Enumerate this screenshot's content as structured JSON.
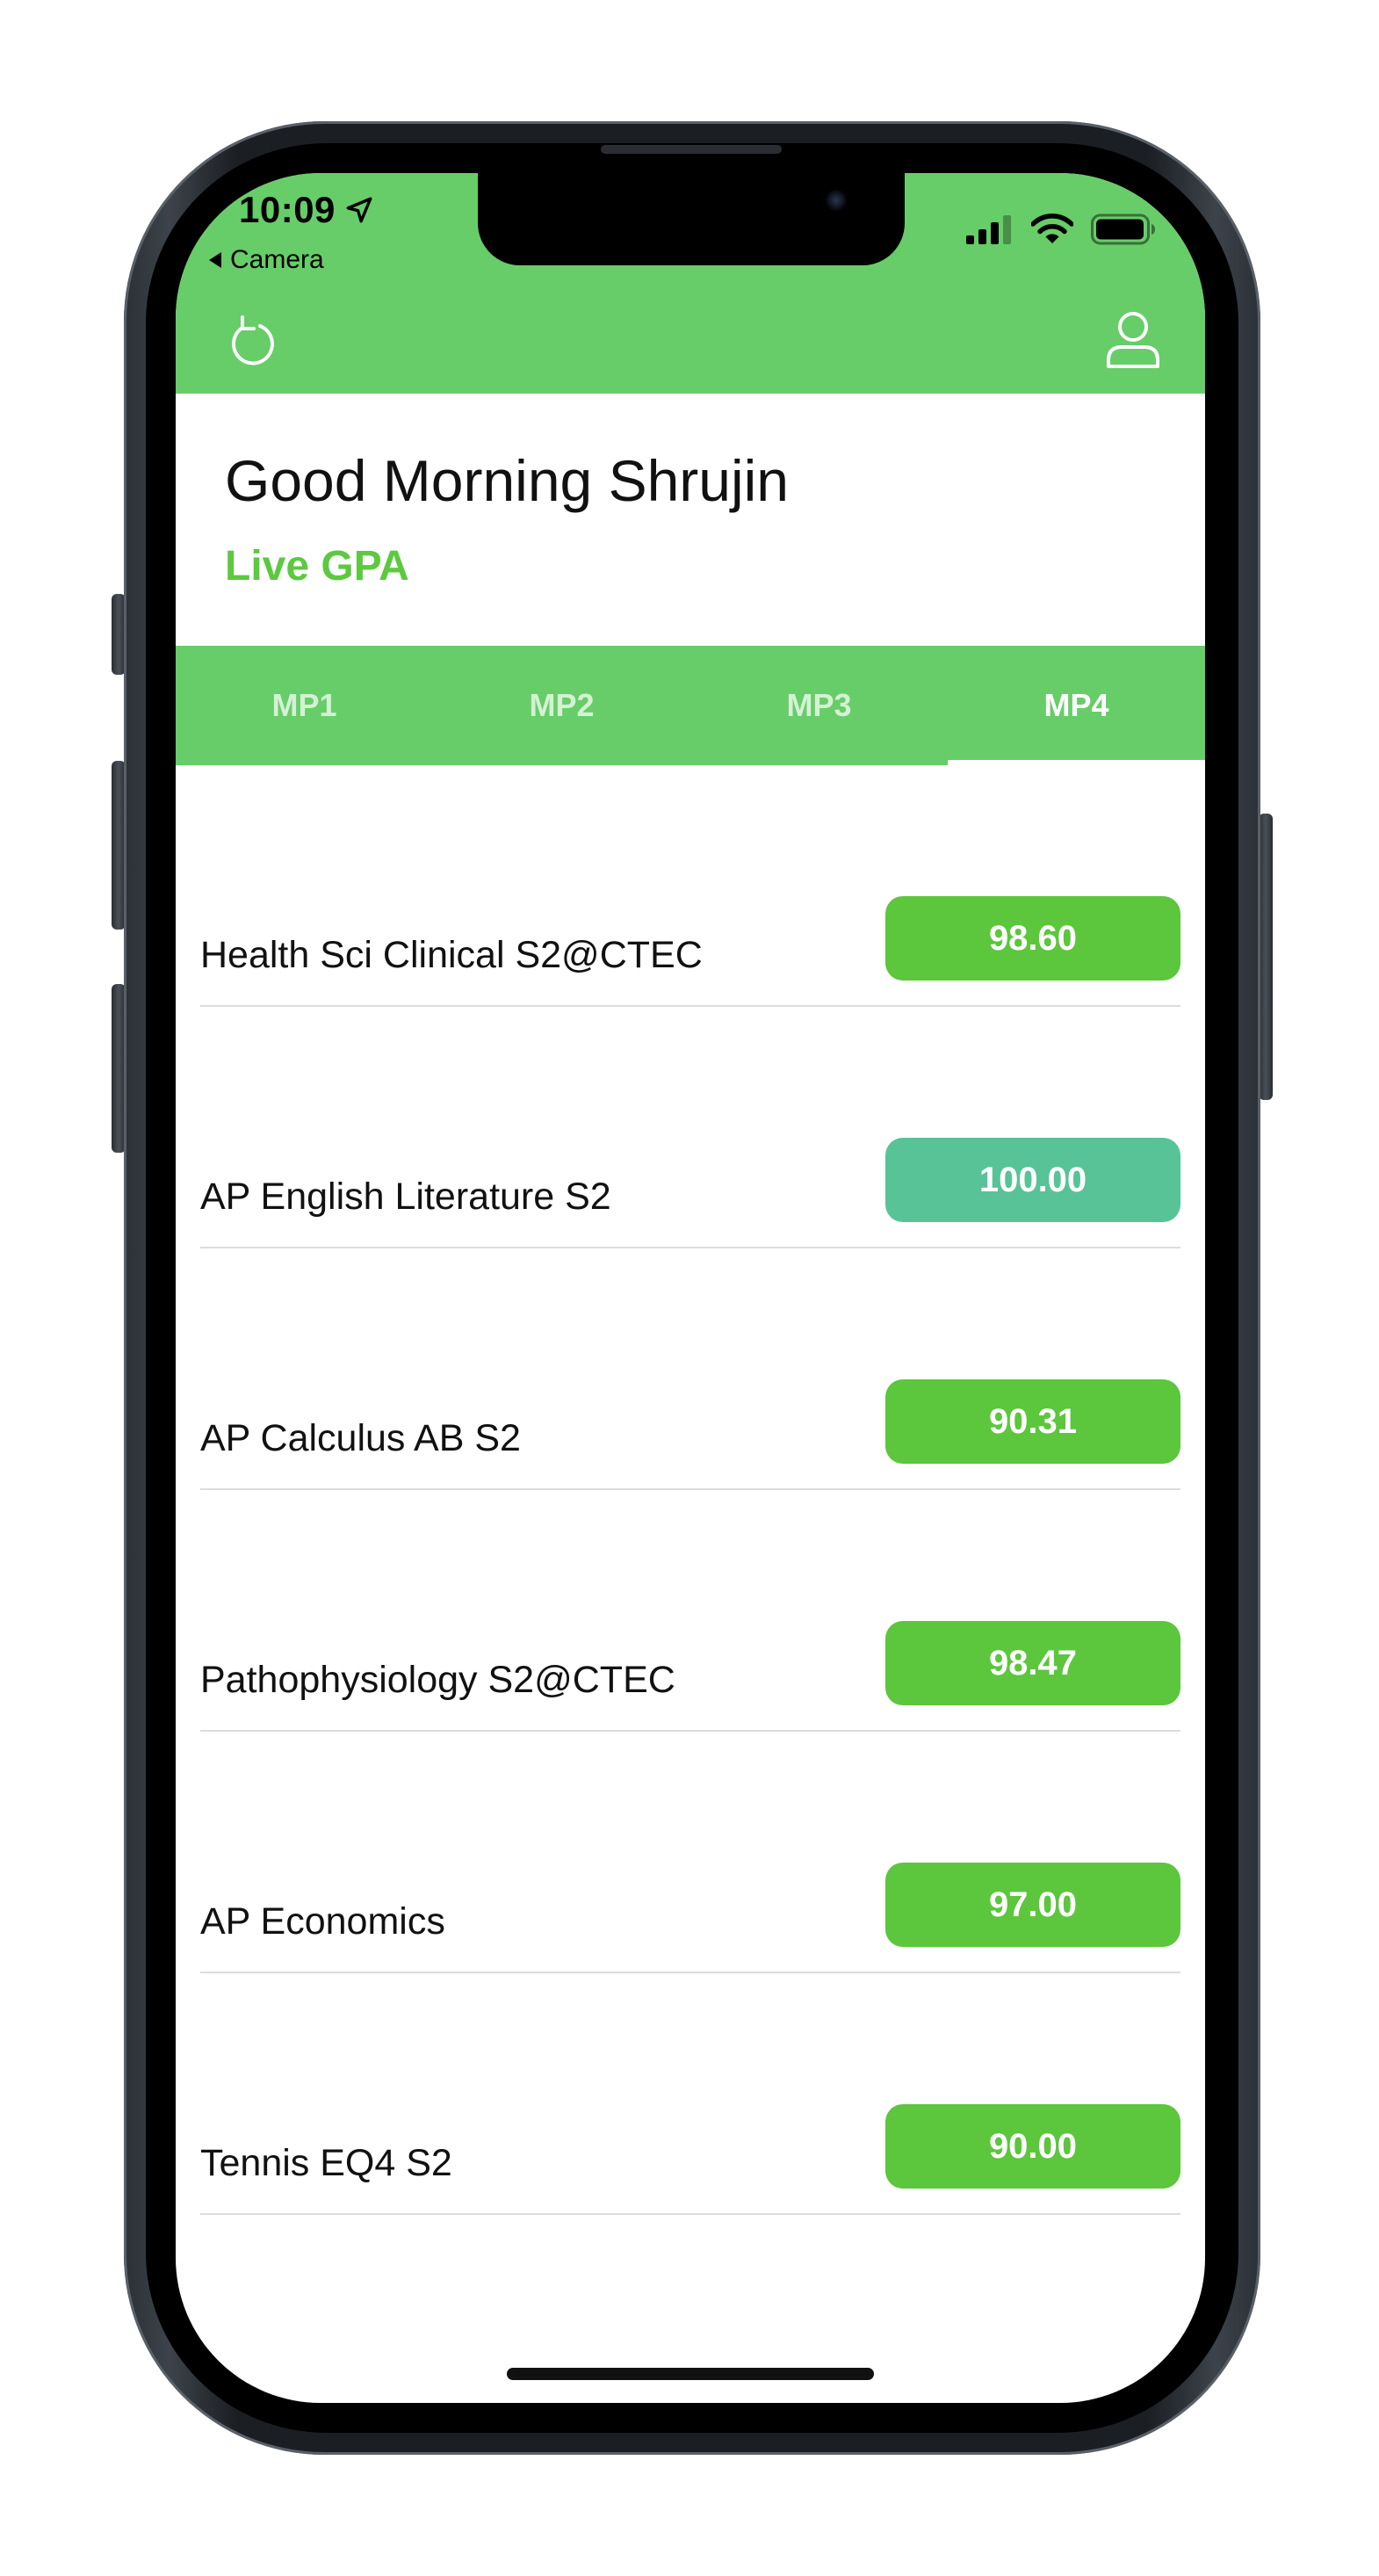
{
  "status_bar": {
    "time": "10:09",
    "back_label": "Camera"
  },
  "header": {
    "refresh_icon": "refresh-icon",
    "profile_icon": "person-icon",
    "background_color": "#67cd68"
  },
  "greeting": "Good Morning Shrujin",
  "subtitle": "Live GPA",
  "tabs": [
    {
      "label": "MP1",
      "active": false
    },
    {
      "label": "MP2",
      "active": false
    },
    {
      "label": "MP3",
      "active": false
    },
    {
      "label": "MP4",
      "active": true
    }
  ],
  "courses": [
    {
      "name": "Health Sci Clinical S2@CTEC",
      "grade": "98.60",
      "color": "#5cc63c"
    },
    {
      "name": "AP English Literature S2",
      "grade": "100.00",
      "color": "#58c397"
    },
    {
      "name": "AP Calculus AB S2",
      "grade": "90.31",
      "color": "#5cc63c"
    },
    {
      "name": "Pathophysiology S2@CTEC",
      "grade": "98.47",
      "color": "#5cc63c"
    },
    {
      "name": "AP Economics",
      "grade": "97.00",
      "color": "#5cc63c"
    },
    {
      "name": "Tennis EQ4 S2",
      "grade": "90.00",
      "color": "#5cc63c"
    }
  ]
}
